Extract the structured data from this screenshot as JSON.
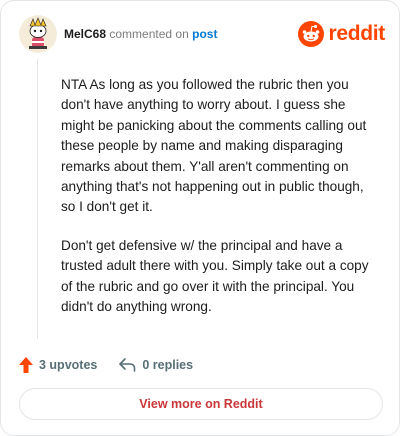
{
  "colors": {
    "brand": "#ff4500",
    "link": "#0079d3",
    "muted": "#576f76",
    "button_text": "#c9373a"
  },
  "header": {
    "username": "MelC68",
    "action_text": "commented on",
    "post_link": "post",
    "avatar_icon": "snoo-avatar-icon",
    "logo_text": "reddit"
  },
  "comment": {
    "paragraphs": [
      "NTA As long as you followed the rubric then you don't have anything to worry about. I guess she might be panicking about the comments calling out these people by name and making disparaging remarks about them. Y'all aren't commenting on anything that's not happening out in public though, so I don't get it.",
      "Don't get defensive w/ the principal and have a trusted adult there with you. Simply take out a copy of the rubric and go over it with the principal. You didn't do anything wrong."
    ]
  },
  "actions": {
    "upvotes": "3 upvotes",
    "replies": "0 replies",
    "upvote_icon": "upvote-arrow-icon",
    "reply_icon": "reply-arrow-icon"
  },
  "footer": {
    "view_more": "View more on Reddit"
  }
}
